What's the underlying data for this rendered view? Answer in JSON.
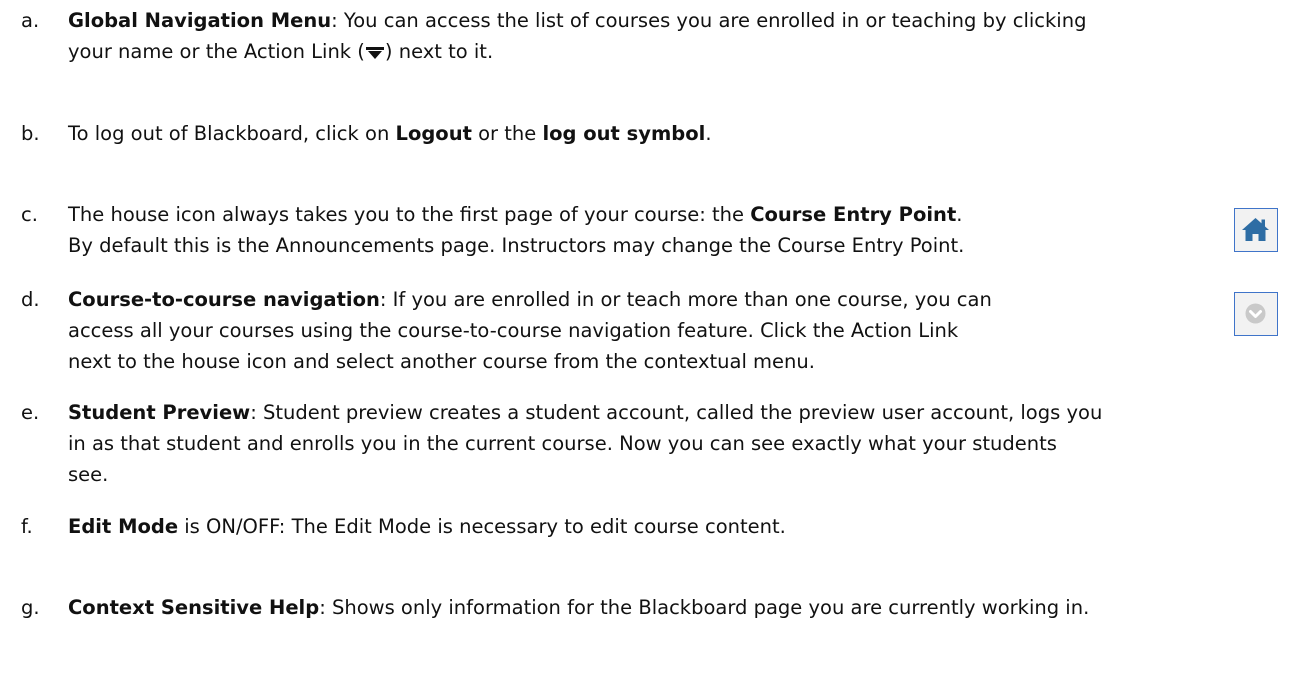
{
  "items": {
    "a": {
      "marker": "a.",
      "term": "Global Navigation Menu",
      "line1_after_term": ": You can access the list of courses you are enrolled in or teaching by clicking",
      "line2_before_icon": "your name or the Action Link (",
      "line2_after_icon": ") next to it."
    },
    "b": {
      "marker": "b.",
      "text1": "To log out of Blackboard, click on ",
      "term1": "Logout",
      "text2": " or the ",
      "term2": "log out symbol",
      "text3": "."
    },
    "c": {
      "marker": "c.",
      "line1_before_term": "The house icon always takes you to the first page of your course: the ",
      "term": "Course Entry Point",
      "line1_after_term": ".",
      "line2": "By default this is the Announcements page. Instructors may change the Course Entry Point."
    },
    "d": {
      "marker": "d.",
      "term": "Course-to-course navigation",
      "line1_after_term": ": If you are enrolled in or teach more than one course, you can",
      "line2": "access all your courses using the course-to-course navigation feature. Click the Action Link",
      "line3": "next to the house icon and select another course from the contextual menu."
    },
    "e": {
      "marker": "e.",
      "term": "Student Preview",
      "line1_after_term": ": Student preview creates a student account, called the preview user account, logs you",
      "line2": "in as that student and enrolls you in the current course. Now you can see exactly what your students",
      "line3": "see."
    },
    "f": {
      "marker": "f.",
      "term": "Edit Mode",
      "line1_after_term": " is ON/OFF: The Edit Mode is necessary to edit course content."
    },
    "g": {
      "marker": "g.",
      "term": "Context Sensitive Help",
      "line1_after_term": ": Shows only information for the Blackboard page you are currently working in."
    }
  },
  "icons": {
    "action_link": "action-link-icon",
    "house": "house-icon",
    "course_chevron": "chevron-down-circle-icon"
  },
  "colors": {
    "text": "#111111",
    "icon_border": "#3f74c9",
    "icon_bg": "#f2f2f2",
    "house_fill": "#2e6da4",
    "chevron_fill": "#c9c9c9"
  }
}
